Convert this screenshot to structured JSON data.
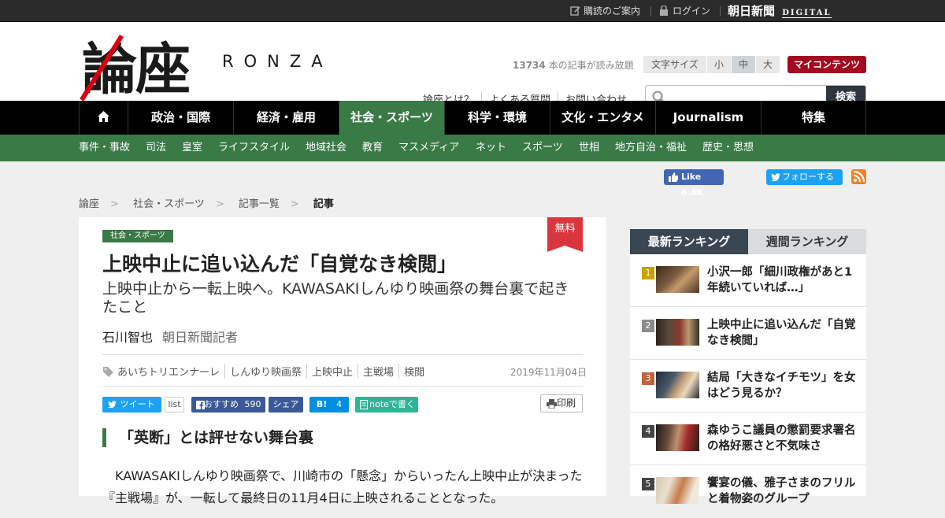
{
  "topbar": {
    "subscribe_label": "購読のご案内",
    "login_label": "ログイン",
    "brand": "朝日新聞",
    "brand_digital": "DIGITAL"
  },
  "header": {
    "logo_kanji": "論座",
    "logo_roman": "RONZA",
    "readable_count": "13734",
    "readable_suffix": " 本の記事が読み放題",
    "fontsize_label": "文字サイズ",
    "fontsize_options": [
      "小",
      "中",
      "大"
    ],
    "fontsize_selected": "中",
    "my_contents": "マイコンテンツ",
    "links": [
      "論座とは？",
      "よくある質問",
      "お問い合わせ"
    ],
    "search_placeholder": "",
    "search_button": "検索"
  },
  "nav": {
    "items": [
      "政治・国際",
      "経済・雇用",
      "社会・スポーツ",
      "科学・環境",
      "文化・エンタメ",
      "Journalism",
      "特集"
    ],
    "active": "社会・スポーツ"
  },
  "subnav": {
    "items": [
      "事件・事故",
      "司法",
      "皇室",
      "ライフスタイル",
      "地域社会",
      "教育",
      "マスメディア",
      "ネット",
      "スポーツ",
      "世相",
      "地方自治・福祉",
      "歴史・思想"
    ]
  },
  "social_top": {
    "fb_like": "Like 6.4K",
    "tw_follow": "フォローする"
  },
  "breadcrumb": [
    "論座",
    "社会・スポーツ",
    "記事一覧",
    "記事"
  ],
  "article": {
    "category": "社会・スポーツ",
    "free_label": "無料",
    "title": "上映中止に追い込んだ「自覚なき検閲」",
    "subtitle": "上映中止から一転上映へ。KAWASAKIしんゆり映画祭の舞台裏で起きたこと",
    "author": "石川智也",
    "author_role": "朝日新聞記者",
    "tags": [
      "あいちトリエンナーレ",
      "しんゆり映画祭",
      "上映中止",
      "主戦場",
      "検閲"
    ],
    "date": "2019年11月04日",
    "share": {
      "tweet": "ツイート",
      "list": "list",
      "fb_recommend": "おすすめ",
      "fb_count": "590",
      "fb_share": "シェア",
      "hatena": "B!",
      "hatena_count": "4",
      "note": "noteで書く",
      "print": "印刷"
    },
    "section_heading": "「英断」とは評せない舞台裏",
    "body": "KAWASAKIしんゆり映画祭で、川崎市の「懸念」からいったん上映中止が決まった『主戦場』が、一転して最終日の11月4日に上映されることとなった。"
  },
  "ranking": {
    "tabs": [
      "最新ランキング",
      "週間ランキング"
    ],
    "active_tab": "最新ランキング",
    "items": [
      {
        "rank": "1",
        "title": "小沢一郎「細川政権があと1年続いていれば…」",
        "color": "#c8a000"
      },
      {
        "rank": "2",
        "title": "上映中止に追い込んだ「自覚なき検閲」",
        "color": "#8c8c8c"
      },
      {
        "rank": "3",
        "title": "結局「大きなイチモツ」を女はどう見るか？",
        "color": "#c0623f"
      },
      {
        "rank": "4",
        "title": "森ゆうこ議員の懲罰要求署名の格好悪さと不気味さ",
        "color": "#444444"
      },
      {
        "rank": "5",
        "title": "饗宴の儀、雅子さまのフリルと着物姿のグループ",
        "color": "#444444"
      }
    ]
  },
  "colors": {
    "accent_green": "#3a7a47",
    "my_red": "#a3091f",
    "free_red": "#d9363e"
  }
}
